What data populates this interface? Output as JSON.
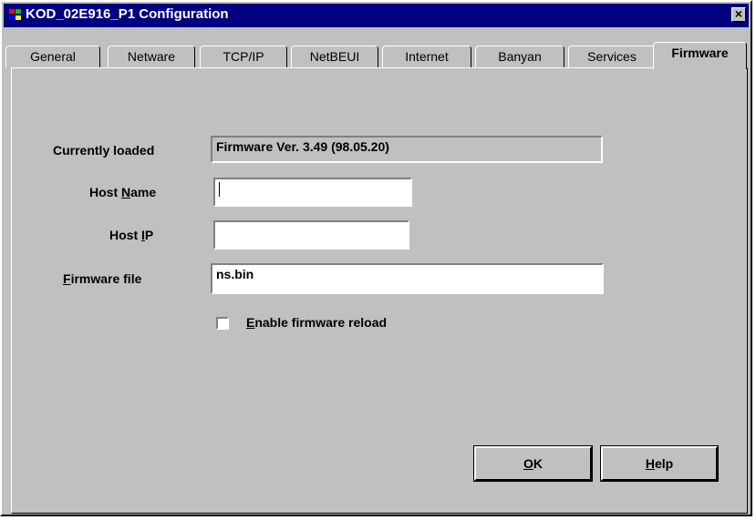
{
  "window": {
    "title": "KOD_02E916_P1 Configuration",
    "close_glyph": "×"
  },
  "tabs": [
    {
      "label": "General"
    },
    {
      "label": "Netware"
    },
    {
      "label": "TCP/IP"
    },
    {
      "label": "NetBEUI"
    },
    {
      "label": "Internet"
    },
    {
      "label": "Banyan"
    },
    {
      "label": "Services"
    },
    {
      "label": "Firmware",
      "active": true
    }
  ],
  "form": {
    "currently_loaded": {
      "label": "Currently loaded",
      "value": "Firmware Ver. 3.49 (98.05.20)"
    },
    "host_name": {
      "label_pre": "Host ",
      "label_key": "N",
      "label_post": "ame",
      "value": ""
    },
    "host_ip": {
      "label_pre": "Host ",
      "label_key": "I",
      "label_post": "P",
      "value": ""
    },
    "firmware_file": {
      "label_key": "F",
      "label_post": "irmware file",
      "value": "ns.bin"
    },
    "enable_reload": {
      "label_key": "E",
      "label_post": "nable firmware reload",
      "checked": false
    }
  },
  "buttons": {
    "ok": {
      "key": "O",
      "rest": "K"
    },
    "help": {
      "key": "H",
      "rest": "elp"
    }
  },
  "colors": {
    "titlebar": "#000080",
    "face": "#c0c0c0"
  }
}
